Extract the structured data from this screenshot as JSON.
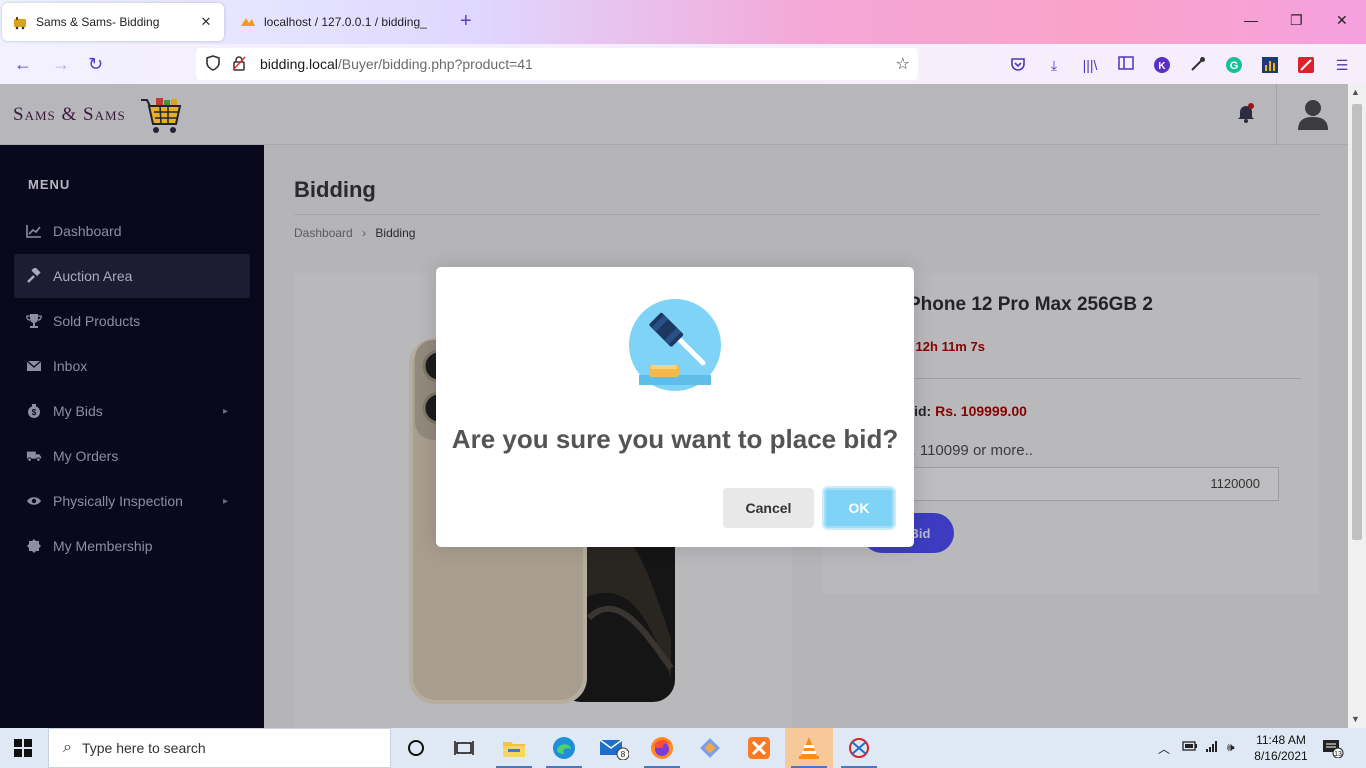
{
  "browser": {
    "tabs": [
      {
        "title": "Sams & Sams- Bidding",
        "active": true
      },
      {
        "title": "localhost / 127.0.0.1 / bidding_",
        "active": false
      }
    ],
    "url_host": "bidding.local",
    "url_path": "/Buyer/bidding.php?product=41"
  },
  "header": {
    "logo_text": "Sams & Sams"
  },
  "sidebar": {
    "menu_label": "MENU",
    "items": [
      {
        "label": "Dashboard",
        "icon": "chart-icon"
      },
      {
        "label": "Auction Area",
        "icon": "gavel-icon",
        "active": true
      },
      {
        "label": "Sold Products",
        "icon": "trophy-icon"
      },
      {
        "label": "Inbox",
        "icon": "envelope-icon"
      },
      {
        "label": "My Bids",
        "icon": "money-bag-icon",
        "has_submenu": true
      },
      {
        "label": "My Orders",
        "icon": "truck-icon"
      },
      {
        "label": "Physically Inspection",
        "icon": "eye-icon",
        "has_submenu": true
      },
      {
        "label": "My Membership",
        "icon": "badge-icon"
      }
    ]
  },
  "main": {
    "page_title": "Bidding",
    "breadcrumb": {
      "home": "Dashboard",
      "current": "Bidding"
    },
    "product_name": "Phone 12 Pro Max 256GB 2",
    "timer_text": "d 12h 11m 7s",
    "current_bid_label": "Bid:",
    "current_bid_amount": "Rs. 109999.00",
    "min_note": "s. 110099 or more..",
    "bid_value": "1120000",
    "place_bid_label": "Bid"
  },
  "modal": {
    "title": "Are you sure you want to place bid?",
    "cancel_label": "Cancel",
    "ok_label": "OK"
  },
  "taskbar": {
    "search_placeholder": "Type here to search",
    "mail_badge": "8",
    "time": "11:48 AM",
    "date": "8/16/2021",
    "notification_count": "13"
  },
  "colors": {
    "sidebar_bg": "#0a081c",
    "ok_button": "#7fd3f7",
    "price_red": "#8a0000",
    "accent": "#3d3cc0"
  }
}
